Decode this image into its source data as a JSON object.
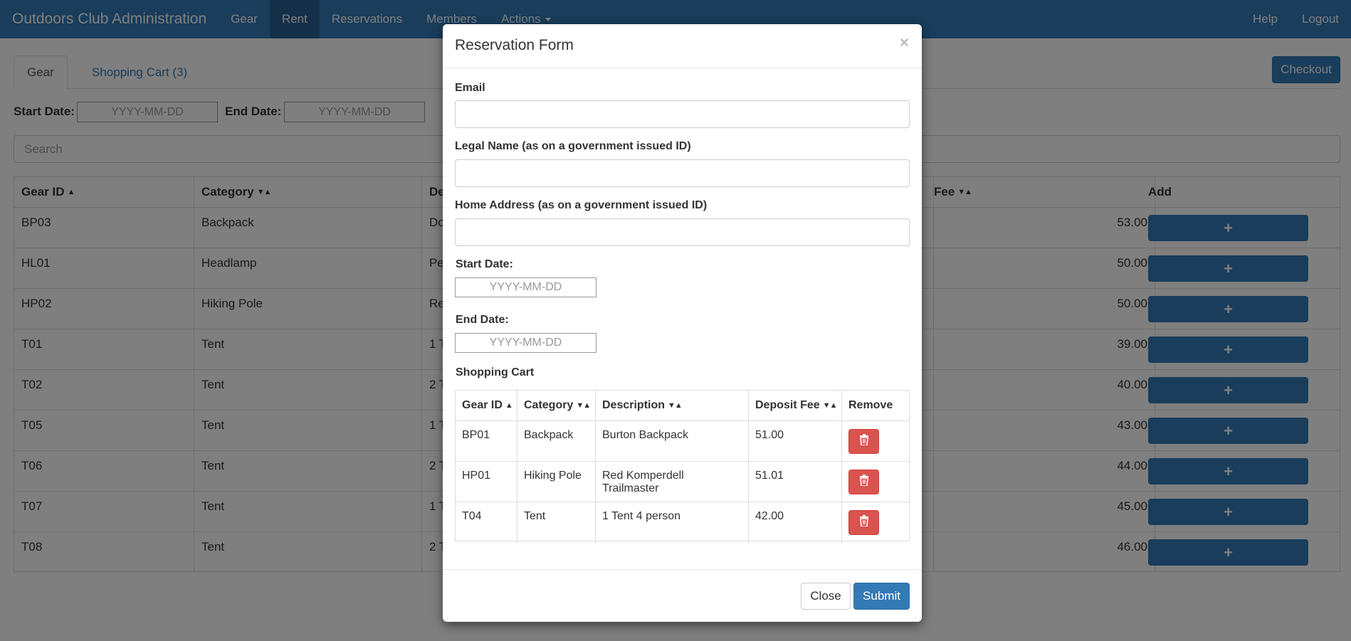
{
  "navbar": {
    "brand": "Outdoors Club Administration",
    "items": [
      "Gear",
      "Rent",
      "Reservations",
      "Members",
      "Actions"
    ],
    "right_items": [
      "Help",
      "Logout"
    ]
  },
  "tabs": [
    "Gear",
    "Shopping Cart (3)"
  ],
  "checkout_label": "Checkout",
  "filters": {
    "start_label": "Start Date:",
    "end_label": "End Date:",
    "start_placeholder": "YYYY-MM-DD",
    "end_placeholder": "YYYY-MM-DD",
    "search_placeholder": "Search"
  },
  "gear_table": {
    "headers": [
      "Gear ID",
      "Category",
      "De",
      "Fee",
      "Add"
    ],
    "rows": [
      {
        "id": "BP03",
        "category": "Backpack",
        "desc": "Do",
        "fee": "53.00"
      },
      {
        "id": "HL01",
        "category": "Headlamp",
        "desc": "Pe",
        "fee": "50.00"
      },
      {
        "id": "HP02",
        "category": "Hiking Pole",
        "desc": "Re",
        "fee": "50.00"
      },
      {
        "id": "T01",
        "category": "Tent",
        "desc": "1 T",
        "fee": "39.00"
      },
      {
        "id": "T02",
        "category": "Tent",
        "desc": "2 T",
        "fee": "40.00"
      },
      {
        "id": "T05",
        "category": "Tent",
        "desc": "1 T",
        "fee": "43.00"
      },
      {
        "id": "T06",
        "category": "Tent",
        "desc": "2 T",
        "fee": "44.00"
      },
      {
        "id": "T07",
        "category": "Tent",
        "desc": "1 T",
        "fee": "45.00"
      },
      {
        "id": "T08",
        "category": "Tent",
        "desc": "2 T",
        "fee": "46.00"
      }
    ],
    "add_glyph": "+"
  },
  "modal": {
    "title": "Reservation Form",
    "close_glyph": "×",
    "email_label": "Email",
    "legal_name_label": "Legal Name (as on a government issued ID)",
    "address_label": "Home Address (as on a government issued ID)",
    "start_label": "Start Date:",
    "end_label": "End Date:",
    "date_placeholder": "YYYY-MM-DD",
    "cart_label": "Shopping Cart",
    "cart_headers": [
      "Gear ID",
      "Category",
      "Description",
      "Deposit Fee",
      "Remove"
    ],
    "cart_rows": [
      {
        "id": "BP01",
        "category": "Backpack",
        "desc": "Burton Backpack",
        "fee": "51.00"
      },
      {
        "id": "HP01",
        "category": "Hiking Pole",
        "desc": "Red Komperdell Trailmaster",
        "fee": "51.01"
      },
      {
        "id": "T04",
        "category": "Tent",
        "desc": "1 Tent 4 person",
        "fee": "42.00"
      }
    ],
    "close_button": "Close",
    "submit_button": "Submit"
  },
  "colors": {
    "primary": "#337ab7",
    "danger": "#d9534f"
  }
}
